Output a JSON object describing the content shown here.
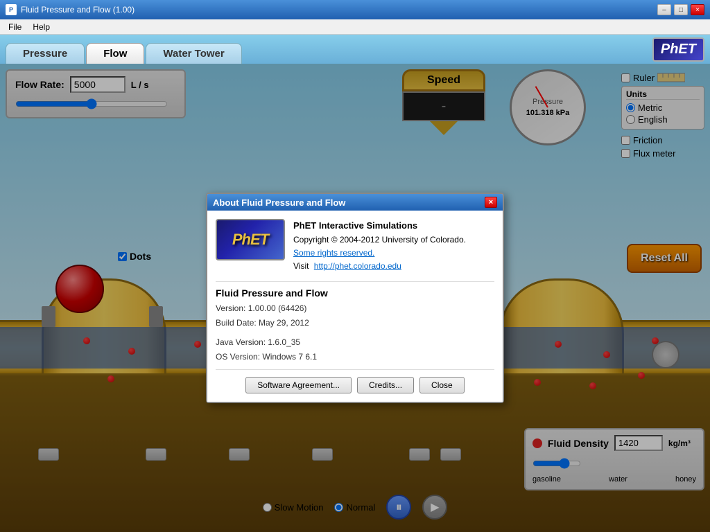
{
  "titlebar": {
    "title": "Fluid Pressure and Flow (1.00)",
    "icon": "PhET",
    "min_label": "–",
    "max_label": "□",
    "close_label": "×"
  },
  "menubar": {
    "file_label": "File",
    "help_label": "Help"
  },
  "tabs": [
    {
      "id": "pressure",
      "label": "Pressure",
      "active": false
    },
    {
      "id": "flow",
      "label": "Flow",
      "active": true
    },
    {
      "id": "watertower",
      "label": "Water Tower",
      "active": false
    }
  ],
  "phet_logo": "PhET",
  "flow_rate": {
    "label": "Flow Rate:",
    "value": "5000",
    "unit": "L / s"
  },
  "speed_gauge": {
    "title": "Speed",
    "value": "-"
  },
  "pressure_gauge": {
    "label": "Pressure",
    "value": "101.318 kPa"
  },
  "right_panel": {
    "ruler_label": "Ruler",
    "units_title": "Units",
    "metric_label": "Metric",
    "english_label": "English",
    "friction_label": "Friction",
    "flux_meter_label": "Flux meter"
  },
  "reset_btn_label": "Reset All",
  "dots_label": "Dots",
  "bottom_controls": {
    "slow_motion_label": "Slow Motion",
    "normal_label": "Normal",
    "pause_symbol": "⏸",
    "step_symbol": "▶"
  },
  "fluid_density": {
    "label": "Fluid Density",
    "value": "1420",
    "unit": "kg/m³",
    "slider_min": "gasoline",
    "slider_mid": "water",
    "slider_max": "honey"
  },
  "about_dialog": {
    "title": "About Fluid Pressure and Flow",
    "close_label": "×",
    "logo_text": "PhET",
    "org_name": "PhET Interactive Simulations",
    "copyright": "Copyright © 2004-2012 University of Colorado.",
    "rights_link": "Some rights reserved.",
    "visit_text": "Visit",
    "website_link": "http://phet.colorado.edu",
    "app_title": "Fluid Pressure and Flow",
    "version": "Version: 1.00.00 (64426)",
    "build_date": "Build Date: May 29, 2012",
    "java_version": "Java Version: 1.6.0_35",
    "os_version": "OS Version: Windows 7 6.1",
    "software_btn": "Software Agreement...",
    "credits_btn": "Credits...",
    "close_btn": "Close"
  }
}
